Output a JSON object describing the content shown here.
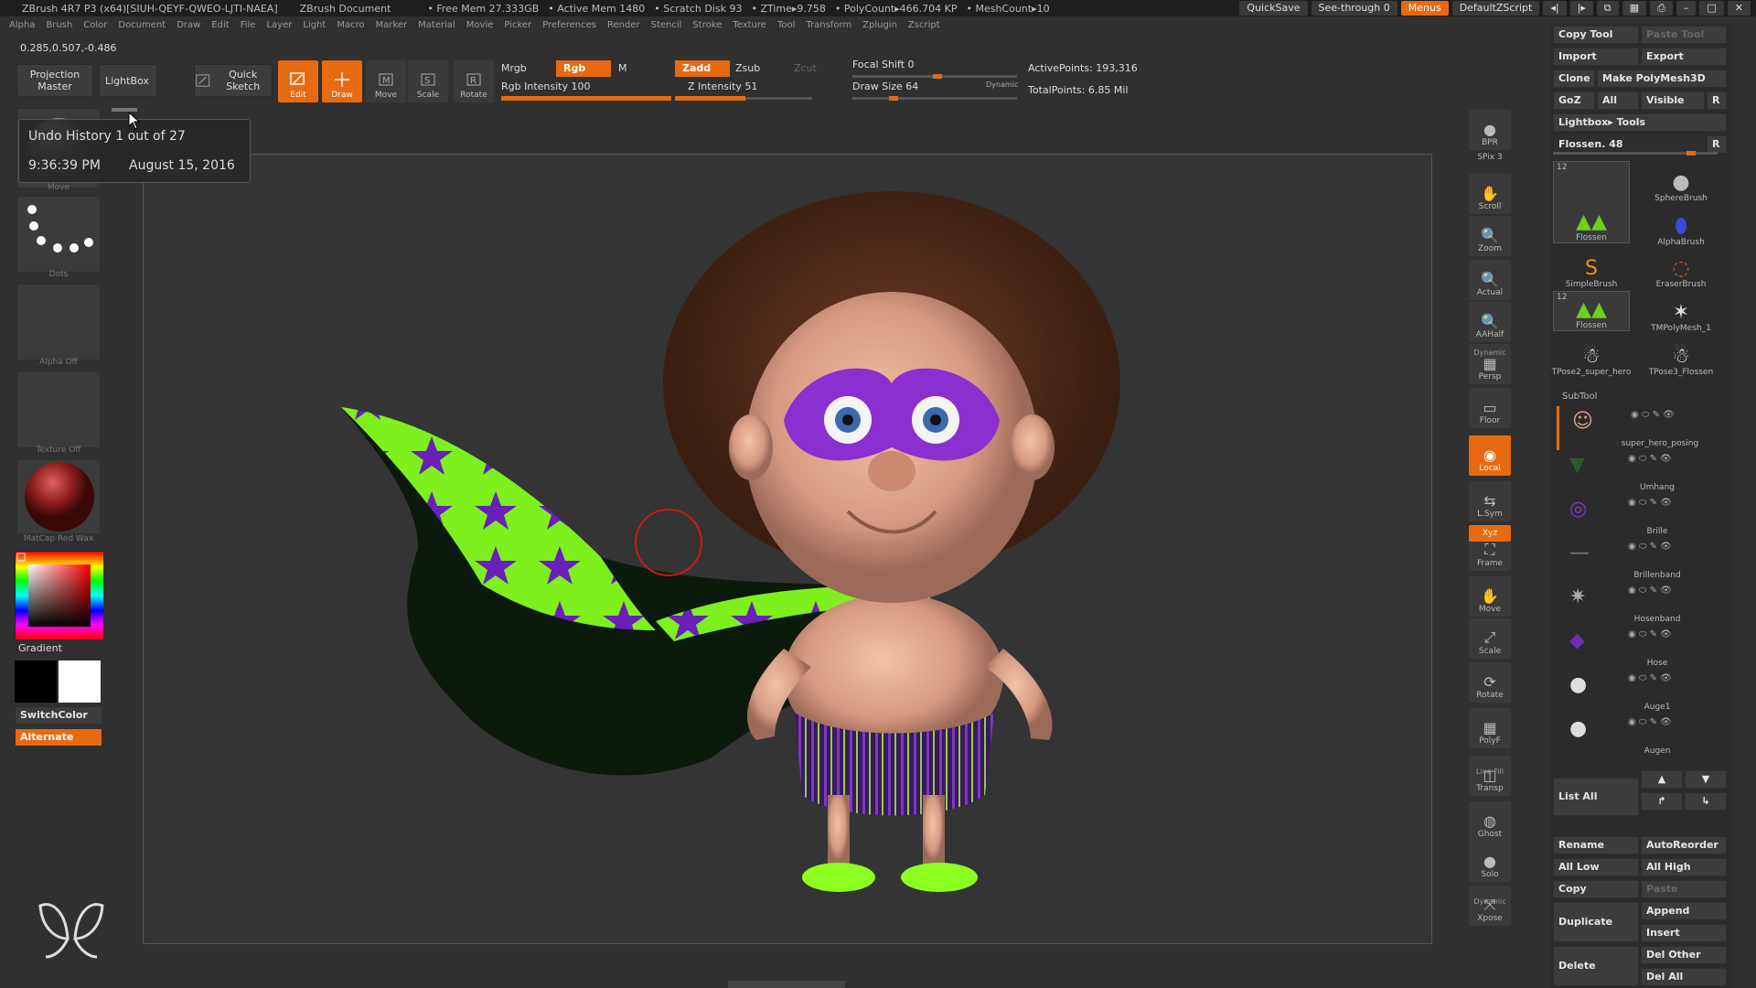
{
  "titlebar": {
    "app": "ZBrush 4R7 P3 (x64)[SIUH-QEYF-QWEO-LJTI-NAEA]",
    "doc": "ZBrush Document",
    "free_mem": "• Free Mem 27.333GB",
    "active_mem": "• Active Mem 1480",
    "scratch": "• Scratch Disk 93",
    "ztime": "• ZTime▸9.758",
    "polycount": "• PolyCount▸466.704 KP",
    "meshcount": "• MeshCount▸10",
    "quicksave": "QuickSave",
    "seethrough": "See-through",
    "seethrough_val": "0",
    "menus": "Menus",
    "script": "DefaultZScript"
  },
  "menubar": [
    "Alpha",
    "Brush",
    "Color",
    "Document",
    "Draw",
    "Edit",
    "File",
    "Layer",
    "Light",
    "Macro",
    "Marker",
    "Material",
    "Movie",
    "Picker",
    "Preferences",
    "Render",
    "Stencil",
    "Stroke",
    "Texture",
    "Tool",
    "Transform",
    "Zplugin",
    "Zscript"
  ],
  "coords": "0.285,0.507,-0.486",
  "toolbar": {
    "projection_master": "Projection Master",
    "lightbox": "LightBox",
    "quick_sketch": "Quick Sketch",
    "edit": "Edit",
    "draw": "Draw",
    "move": "Move",
    "scale": "Scale",
    "rotate": "Rotate",
    "mrgb": "Mrgb",
    "rgb": "Rgb",
    "m": "M",
    "rgb_intensity": "Rgb Intensity 100",
    "rgb_intensity_level": 1.0,
    "zadd": "Zadd",
    "zsub": "Zsub",
    "zcut": "Zcut",
    "z_intensity": "Z Intensity 51",
    "z_intensity_level": 0.51,
    "focal_shift": "Focal Shift 0",
    "draw_size": "Draw Size 64",
    "dynamic": "Dynamic",
    "active_points": "ActivePoints: 193,316",
    "total_points": "TotalPoints: 6.85 Mil"
  },
  "tooltip": {
    "title": "Undo History 1 out of 27",
    "time": "9:36:39 PM",
    "date": "August 15, 2016"
  },
  "leftpanel": {
    "brush_label": "Move",
    "stroke_label": "Dots",
    "alpha_label": "Alpha Off",
    "texture_label": "Texture Off",
    "material_label": "MatCap Red Wax",
    "gradient": "Gradient",
    "switchcolor": "SwitchColor",
    "alternate": "Alternate"
  },
  "rightshelf": [
    "BPR",
    "SPix 3",
    "Scroll",
    "Zoom",
    "Actual",
    "AAHalf",
    "Persp",
    "Floor",
    "Local",
    "L.Sym",
    "Frame",
    "Move",
    "Scale",
    "Rotate",
    "PolyF",
    "Transp",
    "Ghost",
    "Solo",
    "Xpose"
  ],
  "rightshelf_extra": {
    "dynamic": "Dynamic",
    "linefill": "Line Fill",
    "xyz": "Xyz"
  },
  "tool": {
    "copy_tool": "Copy Tool",
    "paste_tool": "Paste Tool",
    "import": "Import",
    "export": "Export",
    "clone": "Clone",
    "make_polymesh": "Make PolyMesh3D",
    "goz": "GoZ",
    "all": "All",
    "visible": "Visible",
    "r": "R",
    "lightbox_tools": "Lightbox▸ Tools",
    "current": "Flossen. 48",
    "brushes": [
      {
        "name": "Flossen",
        "count": "12"
      },
      {
        "name": "SphereBrush"
      },
      {
        "name": "AlphaBrush"
      },
      {
        "name": "SimpleBrush"
      },
      {
        "name": "EraserBrush"
      },
      {
        "name": "Flossen",
        "count": "12"
      },
      {
        "name": "TMPolyMesh_1"
      },
      {
        "name": "TPose2_super_hero"
      },
      {
        "name": "TPose3_Flossen"
      }
    ]
  },
  "subtool": {
    "header": "SubTool",
    "items": [
      "super_hero_posing",
      "Umhang",
      "Brille",
      "Brillenband",
      "Hosenband",
      "Hose",
      "Auge1",
      "Augen"
    ],
    "list_all": "List All",
    "rename": "Rename",
    "autoreorder": "AutoReorder",
    "all_low": "All Low",
    "all_high": "All High",
    "copy": "Copy",
    "paste": "Paste",
    "duplicate": "Duplicate",
    "append": "Append",
    "insert": "Insert",
    "delete": "Delete",
    "del_other": "Del Other",
    "del_all": "Del All"
  },
  "colors": {
    "accent": "#e86a10",
    "panel": "#3c3c3c",
    "bg": "#303030"
  }
}
